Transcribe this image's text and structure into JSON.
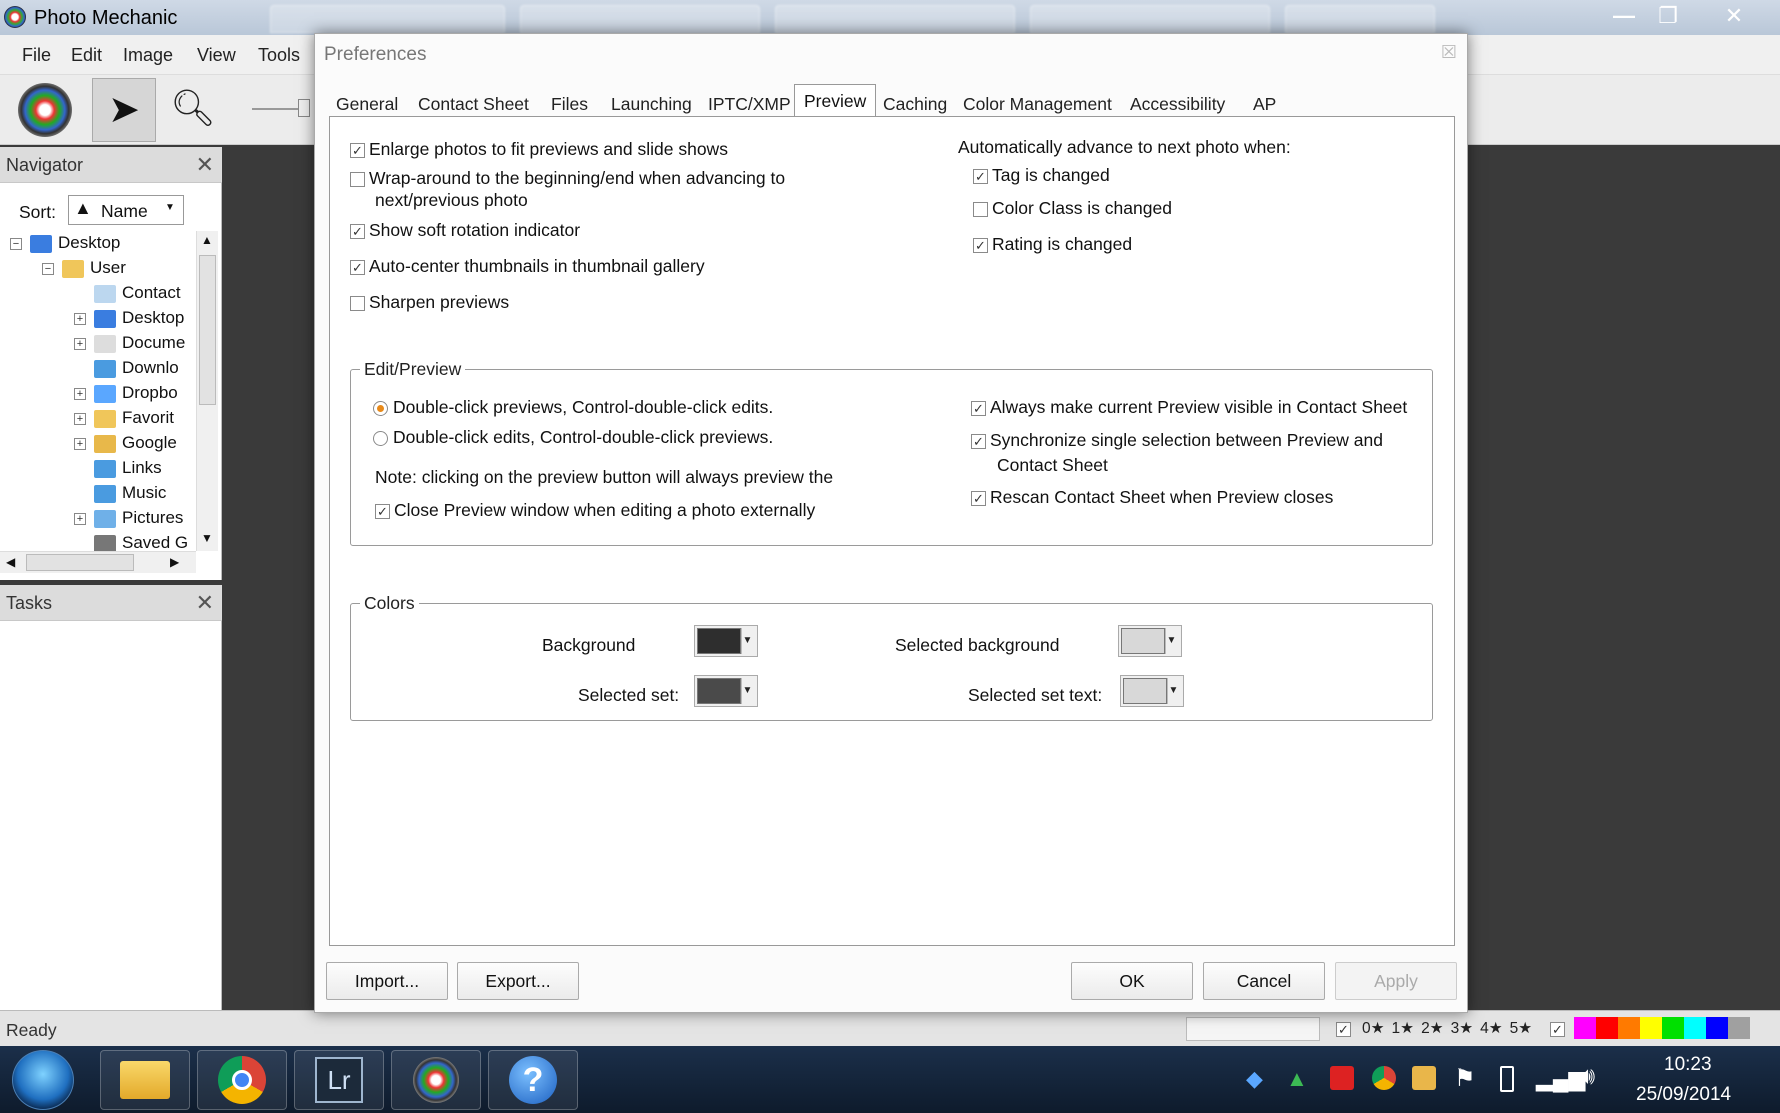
{
  "app": {
    "title": "Photo Mechanic"
  },
  "menu": [
    "File",
    "Edit",
    "Image",
    "View",
    "Tools"
  ],
  "navigator": {
    "title": "Navigator",
    "sort_label": "Sort:",
    "sort_value": "Name",
    "tree": [
      {
        "label": "Desktop",
        "expander": "−"
      },
      {
        "label": "User",
        "expander": "−"
      },
      {
        "label": "Contact",
        "expander": ""
      },
      {
        "label": "Desktop",
        "expander": "+"
      },
      {
        "label": "Docume",
        "expander": "+"
      },
      {
        "label": "Downlo",
        "expander": ""
      },
      {
        "label": "Dropbo",
        "expander": "+"
      },
      {
        "label": "Favorit",
        "expander": "+"
      },
      {
        "label": "Google",
        "expander": "+"
      },
      {
        "label": "Links",
        "expander": ""
      },
      {
        "label": "Music",
        "expander": ""
      },
      {
        "label": "Pictures",
        "expander": "+"
      },
      {
        "label": "Saved G",
        "expander": ""
      }
    ]
  },
  "tasks": {
    "title": "Tasks"
  },
  "status": {
    "text": "Ready",
    "ratings": [
      "0★",
      "1★",
      "2★",
      "3★",
      "4★",
      "5★"
    ],
    "color_classes": [
      "#ff00ff",
      "#ff0000",
      "#ff7a00",
      "#ffff00",
      "#00e000",
      "#00ffff",
      "#0000ff",
      "#a0a0a0"
    ]
  },
  "taskbar": {
    "time": "10:23",
    "date": "25/09/2014",
    "apps": [
      "start-orb",
      "explorer",
      "chrome",
      "lightroom",
      "photo-mechanic",
      "help"
    ]
  },
  "dialog": {
    "title": "Preferences",
    "tabs": [
      "General",
      "Contact Sheet",
      "Files",
      "Launching",
      "IPTC/XMP",
      "Preview",
      "Caching",
      "Color Management",
      "Accessibility",
      "AP"
    ],
    "active_tab": "Preview",
    "left_options": [
      {
        "label": "Enlarge photos to fit previews and slide shows",
        "checked": true
      },
      {
        "label": "Wrap-around to the beginning/end when advancing to",
        "label2": "next/previous photo",
        "checked": false
      },
      {
        "label": "Show soft rotation indicator",
        "checked": true
      },
      {
        "label": "Auto-center thumbnails in thumbnail gallery",
        "checked": true
      },
      {
        "label": "Sharpen previews",
        "checked": false
      }
    ],
    "advance_heading": "Automatically advance to next photo when:",
    "advance_options": [
      {
        "label": "Tag is changed",
        "checked": true
      },
      {
        "label": "Color Class is changed",
        "checked": false
      },
      {
        "label": "Rating is changed",
        "checked": true
      }
    ],
    "edit_preview": {
      "legend": "Edit/Preview",
      "radios": [
        {
          "label": "Double-click previews, Control-double-click edits.",
          "selected": true
        },
        {
          "label": "Double-click edits, Control-double-click previews.",
          "selected": false
        }
      ],
      "note": "Note: clicking on the preview button will always preview the",
      "close_preview": {
        "label": "Close Preview window when editing a photo externally",
        "checked": true
      },
      "right_options": [
        {
          "label": "Always make current Preview visible in Contact Sheet",
          "checked": true
        },
        {
          "label": "Synchronize single selection between Preview and",
          "label2": "Contact Sheet",
          "checked": true
        },
        {
          "label": "Rescan Contact Sheet when Preview closes",
          "checked": true
        }
      ]
    },
    "colors": {
      "legend": "Colors",
      "background": {
        "label": "Background",
        "color": "#2e2e2e"
      },
      "selected_set": {
        "label": "Selected set:",
        "color": "#4a4a4a"
      },
      "selected_background": {
        "label": "Selected background",
        "color": "#d8d8d8"
      },
      "selected_set_text": {
        "label": "Selected set text:",
        "color": "#d8d8d8"
      }
    },
    "buttons": {
      "import": "Import...",
      "export": "Export...",
      "ok": "OK",
      "cancel": "Cancel",
      "apply": "Apply"
    }
  }
}
